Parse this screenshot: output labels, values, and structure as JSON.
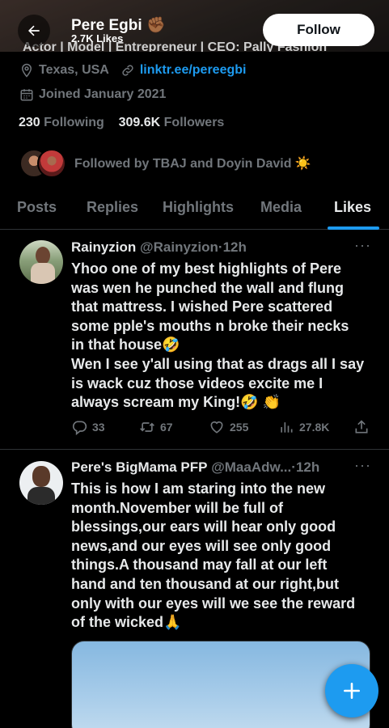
{
  "header": {
    "name": "Pere Egbi",
    "name_emoji": "✊🏾",
    "likes": "2.7K Likes",
    "follow_label": "Follow",
    "cut_bio": "Actor | Model | Entrepreneur | CEO: Pally Fashion"
  },
  "profile": {
    "location": "Texas, USA",
    "link": "linktr.ee/pereegbi",
    "joined": "Joined January 2021",
    "following_count": "230",
    "following_label": "Following",
    "followers_count": "309.6K",
    "followers_label": "Followers",
    "followed_by": "Followed by TBAJ and Doyin David ☀️"
  },
  "tabs": [
    "Posts",
    "Replies",
    "Highlights",
    "Media",
    "Likes"
  ],
  "active_tab": "Likes",
  "tweets": [
    {
      "name": "Rainyzion",
      "handle": "@Rainyzion",
      "time": "12h",
      "text": "Yhoo one of my best highlights of Pere\nwas wen he punched the wall and flung\nthat mattress. I wished Pere scattered\nsome pple's mouths n broke their necks\nin that house🤣\nWen I see y'all using that as drags all I say\nis wack cuz those videos excite me I\nalways scream my King!🤣 👏",
      "replies": "33",
      "retweets": "67",
      "likes": "255",
      "views": "27.8K"
    },
    {
      "name": "Pere's BigMama PFP",
      "handle": "@MaaAdw...",
      "time": "12h",
      "text": "This is how I am staring into the new\nmonth.November will be full of\nblessings,our ears will hear only good\nnews,and our eyes will see only good\nthings.A thousand may fall at our left\nhand and ten thousand at our right,but\nonly with our eyes will we see the reward\nof the wicked🙏"
    }
  ],
  "colors": {
    "accent": "#1d9bf0",
    "text_primary": "#e7e9ea",
    "text_secondary": "#71767b",
    "background": "#000000"
  },
  "icons": [
    "back-arrow-icon",
    "location-icon",
    "link-icon",
    "calendar-icon",
    "reply-icon",
    "retweet-icon",
    "like-icon",
    "views-icon",
    "share-icon",
    "more-icon",
    "compose-plus-icon"
  ]
}
